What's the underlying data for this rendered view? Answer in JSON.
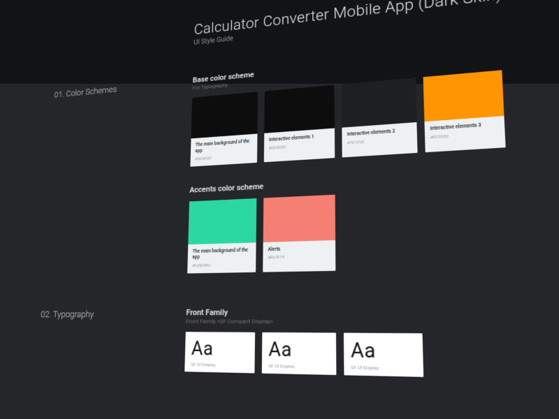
{
  "header": {
    "title": "Calculator Converter Mobile App (Dark Skin)",
    "subtitle": "UI Style Guide"
  },
  "sections": {
    "colors": {
      "num": "01. Color Schemes",
      "base": {
        "title": "Base color scheme",
        "sub": "For Typography",
        "swatches": [
          {
            "label": "The main background of the app",
            "hex": "#0D0D0D",
            "chip": "#0D0D0D"
          },
          {
            "label": "Interactive elements 1",
            "hex": "#0D0D0D",
            "chip": "#0D0D0D"
          },
          {
            "label": "Interactive elements 2",
            "hex": "#1E1F20",
            "chip": "#1E1F20"
          },
          {
            "label": "Interactive elements 3",
            "hex": "#FF9500",
            "chip": "#FF9500"
          }
        ]
      },
      "accents": {
        "title": "Accents color scheme",
        "sub": "",
        "swatches": [
          {
            "label": "The main background of the app",
            "hex": "#h28D882",
            "chip": "#2BD8A2"
          },
          {
            "label": "Alerts",
            "hex": "#F67F74",
            "chip": "#F67F74"
          }
        ]
      }
    },
    "typography": {
      "num": "02. Typography",
      "group": {
        "title": "Front Family",
        "sub": "Front Family «SF Compact Display»",
        "cards": [
          {
            "sample": "Aa",
            "name": "SF UI Display"
          },
          {
            "sample": "Aa",
            "name": "SF UI Display"
          },
          {
            "sample": "Aa",
            "name": "SF UI Display"
          }
        ]
      }
    }
  }
}
